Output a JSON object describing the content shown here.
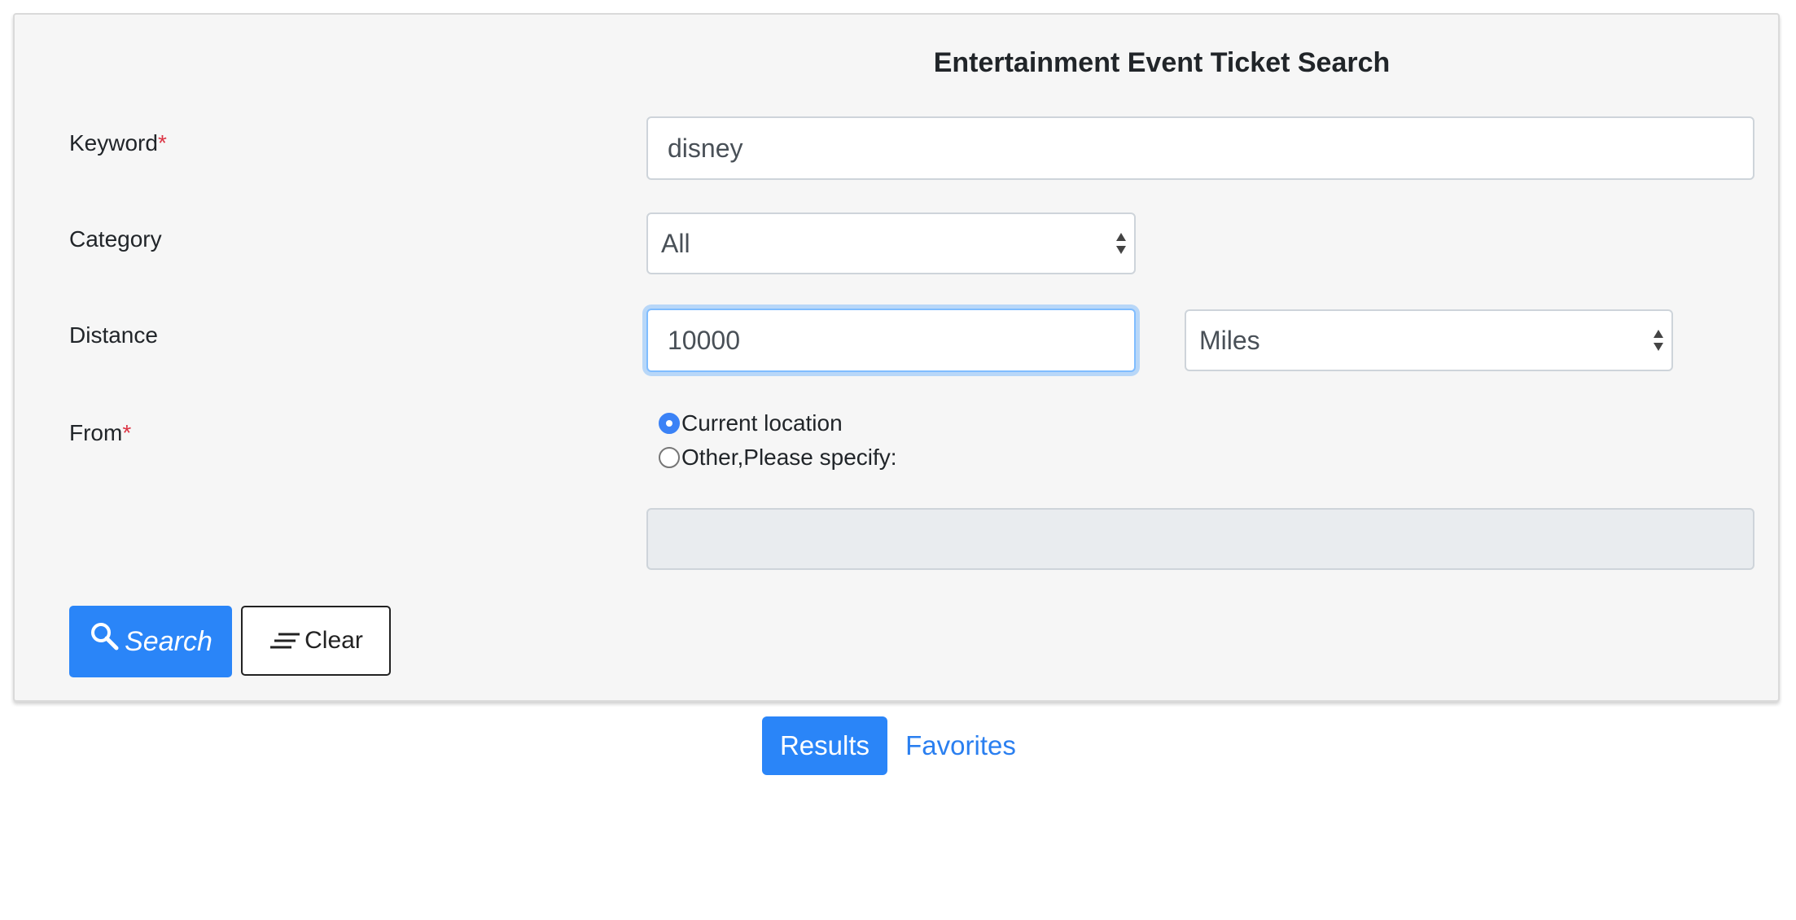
{
  "form": {
    "title": "Entertainment Event Ticket Search",
    "required_mark": "*",
    "keyword": {
      "label": "Keyword",
      "value": "disney"
    },
    "category": {
      "label": "Category",
      "selected": "All"
    },
    "distance": {
      "label": "Distance",
      "value": "10000",
      "unit_selected": "Miles"
    },
    "from": {
      "label": "From",
      "options": [
        {
          "label": "Current location",
          "checked": true
        },
        {
          "label": "Other,Please specify:",
          "checked": false
        }
      ],
      "location_value": ""
    },
    "buttons": {
      "search_label": "Search",
      "clear_label": "Clear"
    }
  },
  "tabs": [
    {
      "label": "Results",
      "active": true
    },
    {
      "label": "Favorites",
      "active": false
    }
  ],
  "colors": {
    "primary": "#2a85f8",
    "required": "#dc3545",
    "panel_bg": "#f6f6f6",
    "focus_ring": "#80bdff"
  }
}
